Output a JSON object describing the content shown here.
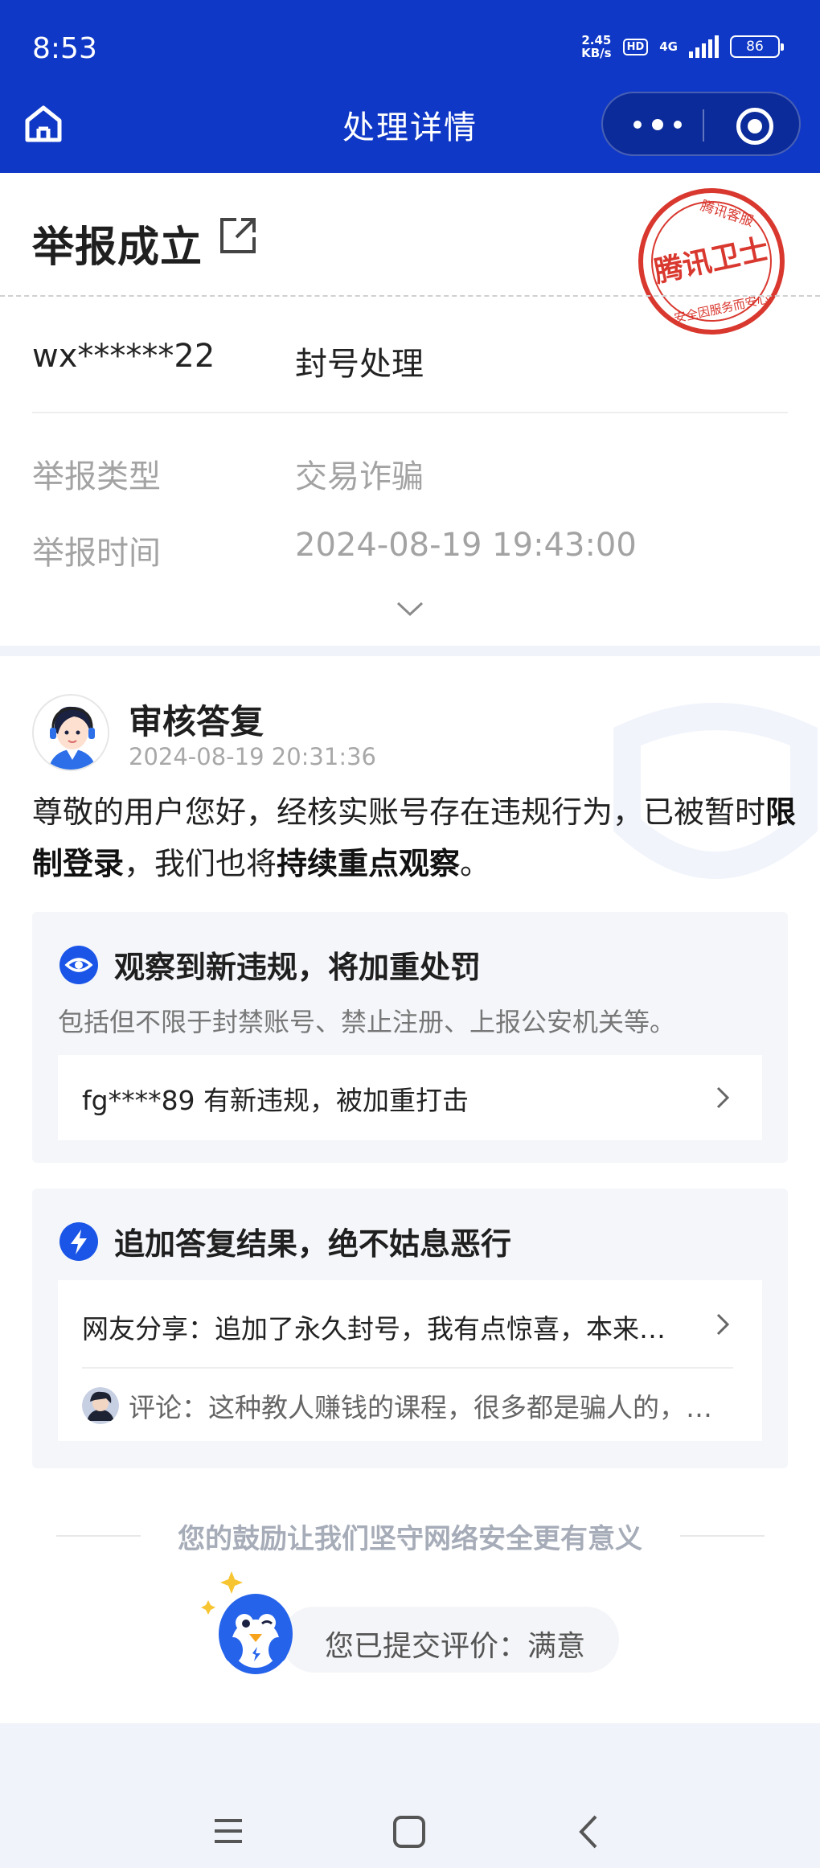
{
  "status_bar": {
    "time": "8:53",
    "speed_value": "2.45",
    "speed_unit": "KB/s",
    "hd_badge": "HD",
    "network": "4G",
    "battery": "86"
  },
  "header": {
    "title": "处理详情",
    "bg_color": "#0f38c6"
  },
  "report": {
    "title": "举报成立",
    "stamp_text": "腾讯卫士",
    "stamp_top": "腾讯客服",
    "stamp_bottom": "安全因服务而安心",
    "account": "wx******22",
    "action": "封号处理",
    "type_label": "举报类型",
    "type_value": "交易诈骗",
    "time_label": "举报时间",
    "time_value": "2024-08-19 19:43:00"
  },
  "reply": {
    "title": "审核答复",
    "time": "2024-08-19 20:31:36",
    "body_1": "尊敬的用户您好，经核实账号存在违规行为，已被暂时",
    "body_bold_1": "限制登录",
    "body_2": "，我们也将",
    "body_bold_2": "持续重点观察",
    "body_3": "。"
  },
  "observe": {
    "title": "观察到新违规，将加重处罚",
    "subtitle": "包括但不限于封禁账号、禁止注册、上报公安机关等。",
    "item": "fg****89 有新违规，被加重打击"
  },
  "followup": {
    "title": "追加答复结果，绝不姑息恶行",
    "share": "网友分享：追加了永久封号，我有点惊喜，本来…",
    "comment": "评论：这种教人赚钱的课程，很多都是骗人的，…"
  },
  "feedback": {
    "encourage": "您的鼓励让我们坚守网络安全更有意义",
    "rating": "您已提交评价：满意"
  },
  "accent_color": "#1a55e8",
  "stamp_color": "#d9382f"
}
